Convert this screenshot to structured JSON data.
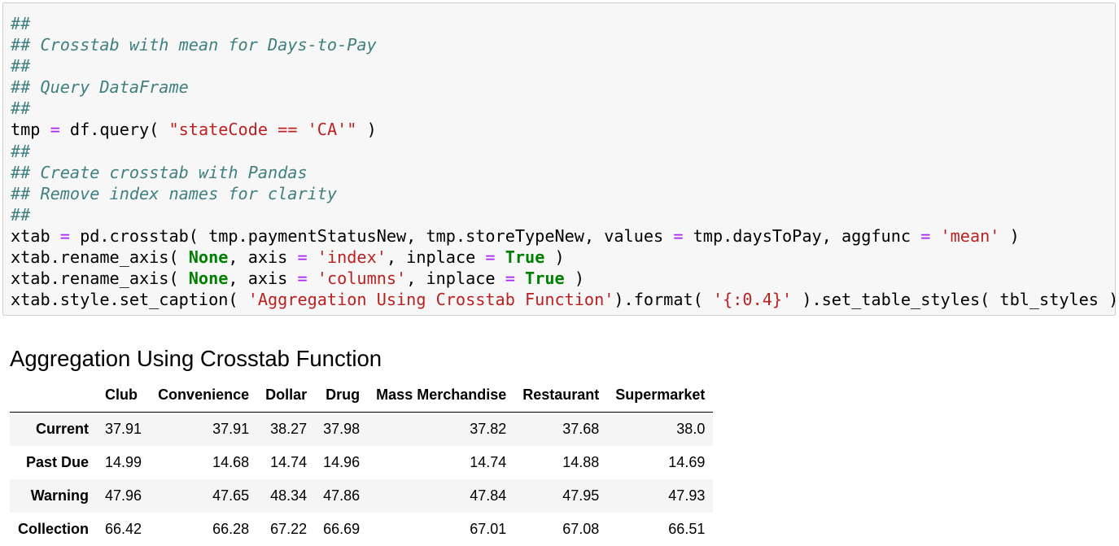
{
  "code_lines": [
    [
      {
        "t": "##",
        "c": "c"
      }
    ],
    [
      {
        "t": "## Crosstab with mean for Days-to-Pay",
        "c": "c"
      }
    ],
    [
      {
        "t": "##",
        "c": "c"
      }
    ],
    [
      {
        "t": "## Query DataFrame",
        "c": "c"
      }
    ],
    [
      {
        "t": "##",
        "c": "c"
      }
    ],
    [
      {
        "t": "tmp "
      },
      {
        "t": "=",
        "c": "o"
      },
      {
        "t": " df.query( "
      },
      {
        "t": "\"stateCode == 'CA'\"",
        "c": "s"
      },
      {
        "t": " )"
      }
    ],
    [
      {
        "t": "##",
        "c": "c"
      }
    ],
    [
      {
        "t": "## Create crosstab with Pandas",
        "c": "c"
      }
    ],
    [
      {
        "t": "## Remove index names for clarity",
        "c": "c"
      }
    ],
    [
      {
        "t": "##",
        "c": "c"
      }
    ],
    [
      {
        "t": "xtab "
      },
      {
        "t": "=",
        "c": "o"
      },
      {
        "t": " pd.crosstab( tmp.paymentStatusNew, tmp.storeTypeNew, values "
      },
      {
        "t": "=",
        "c": "o"
      },
      {
        "t": " tmp.daysToPay, aggfunc "
      },
      {
        "t": "=",
        "c": "o"
      },
      {
        "t": " "
      },
      {
        "t": "'mean'",
        "c": "s"
      },
      {
        "t": " )"
      }
    ],
    [
      {
        "t": "xtab.rename_axis( "
      },
      {
        "t": "None",
        "c": "k"
      },
      {
        "t": ", axis "
      },
      {
        "t": "=",
        "c": "o"
      },
      {
        "t": " "
      },
      {
        "t": "'index'",
        "c": "s"
      },
      {
        "t": ", inplace "
      },
      {
        "t": "=",
        "c": "o"
      },
      {
        "t": " "
      },
      {
        "t": "True",
        "c": "k"
      },
      {
        "t": " )"
      }
    ],
    [
      {
        "t": "xtab.rename_axis( "
      },
      {
        "t": "None",
        "c": "k"
      },
      {
        "t": ", axis "
      },
      {
        "t": "=",
        "c": "o"
      },
      {
        "t": " "
      },
      {
        "t": "'columns'",
        "c": "s"
      },
      {
        "t": ", inplace "
      },
      {
        "t": "=",
        "c": "o"
      },
      {
        "t": " "
      },
      {
        "t": "True",
        "c": "k"
      },
      {
        "t": " )"
      }
    ],
    [
      {
        "t": "xtab.style.set_caption( "
      },
      {
        "t": "'Aggregation Using Crosstab Function'",
        "c": "s"
      },
      {
        "t": ").format( "
      },
      {
        "t": "'{:0.4}'",
        "c": "s"
      },
      {
        "t": " ).set_table_styles( tbl_styles )"
      }
    ]
  ],
  "output": {
    "caption": "Aggregation Using Crosstab Function",
    "columns": [
      "Club",
      "Convenience",
      "Dollar",
      "Drug",
      "Mass Merchandise",
      "Restaurant",
      "Supermarket"
    ],
    "rows": [
      {
        "label": "Current",
        "values": [
          "37.91",
          "37.91",
          "38.27",
          "37.98",
          "37.82",
          "37.68",
          "38.0"
        ]
      },
      {
        "label": "Past Due",
        "values": [
          "14.99",
          "14.68",
          "14.74",
          "14.96",
          "14.74",
          "14.88",
          "14.69"
        ]
      },
      {
        "label": "Warning",
        "values": [
          "47.96",
          "47.65",
          "48.34",
          "47.86",
          "47.84",
          "47.95",
          "47.93"
        ]
      },
      {
        "label": "Collection",
        "values": [
          "66.42",
          "66.28",
          "67.22",
          "66.69",
          "67.01",
          "67.08",
          "66.51"
        ]
      }
    ]
  }
}
